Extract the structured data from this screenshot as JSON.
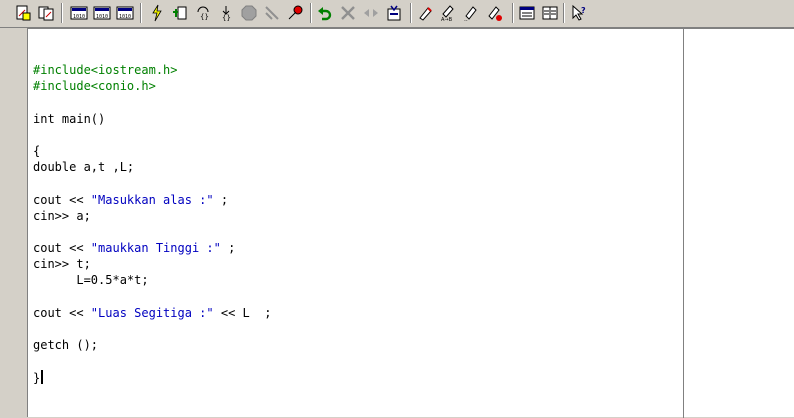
{
  "toolbar": {
    "buttons": [
      "new-file-icon",
      "open-file-icon",
      "compile-icon",
      "compile-run-icon",
      "rebuild-icon",
      "lightning-icon",
      "debug-icon",
      "step-over-icon",
      "step-into-icon",
      "stop-icon",
      "run-to-cursor-icon",
      "breakpoint-icon",
      "undo-icon",
      "close-icon",
      "split-icon",
      "find-icon",
      "mark-icon",
      "replace-icon",
      "find-next-icon",
      "toggle-icon",
      "window-icon",
      "columns-icon",
      "help-icon"
    ]
  },
  "code": {
    "lines": [
      "#include<iostream.h>",
      "#include<conio.h>",
      "",
      "int main()",
      "",
      "{",
      "double a,t ,L;",
      "",
      "cout << \"Masukkan alas :\" ;",
      "cin>> a;",
      "",
      "cout << \"maukkan Tinggi :\" ;",
      "cin>> t;",
      "      L=0.5*a*t;",
      "",
      "cout << \"Luas Segitiga :\" << L  ;",
      "",
      "getch ();",
      "",
      "}"
    ]
  },
  "colors": {
    "preprocessor": "#008000",
    "string": "#0000c0",
    "default": "#000000"
  }
}
